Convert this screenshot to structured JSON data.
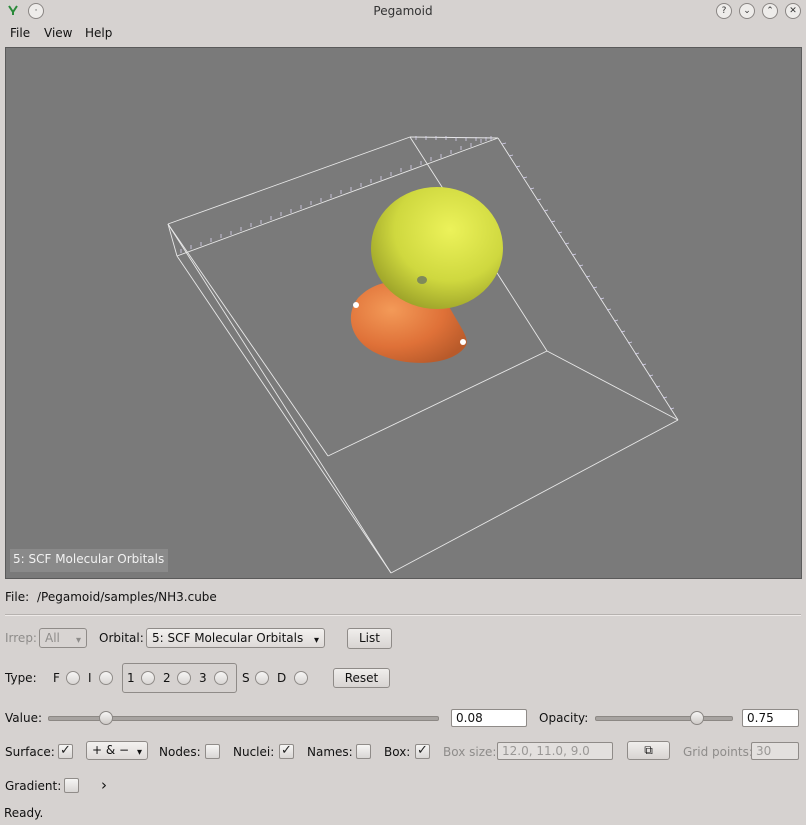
{
  "window": {
    "title": "Pegamoid"
  },
  "menu": {
    "file": "File",
    "view": "View",
    "help": "Help"
  },
  "viewport": {
    "overlay_label": "5: SCF Molecular Orbitals"
  },
  "file_row": {
    "label": "File:",
    "path": "/Pegamoid/samples/NH3.cube"
  },
  "irrep": {
    "label": "Irrep:",
    "value": "All"
  },
  "orbital": {
    "label": "Orbital:",
    "value": "5: SCF Molecular Orbitals"
  },
  "list_button": "List",
  "type_row": {
    "label": "Type:",
    "options": [
      "F",
      "I",
      "1",
      "2",
      "3",
      "S",
      "D"
    ]
  },
  "reset_button": "Reset",
  "value_row": {
    "label": "Value:",
    "value": "0.08",
    "slider_fraction": 0.15
  },
  "opacity_row": {
    "label": "Opacity:",
    "value": "0.75",
    "slider_fraction": 0.75
  },
  "surface": {
    "label": "Surface:",
    "checked": true,
    "mode": "+ & −"
  },
  "nodes": {
    "label": "Nodes:",
    "checked": false
  },
  "nuclei": {
    "label": "Nuclei:",
    "checked": true
  },
  "names": {
    "label": "Names:",
    "checked": false
  },
  "box": {
    "label": "Box:",
    "checked": true
  },
  "box_size": {
    "label": "Box size:",
    "value": "12.0, 11.0, 9.0"
  },
  "grid_points": {
    "label": "Grid points:",
    "value": "30"
  },
  "gradient": {
    "label": "Gradient:",
    "checked": false,
    "expander": "›"
  },
  "status": "Ready.",
  "colors": {
    "lobe_positive": "#d9e24a",
    "lobe_negative": "#e47a3e",
    "viewport_bg": "#7a7a7a"
  }
}
